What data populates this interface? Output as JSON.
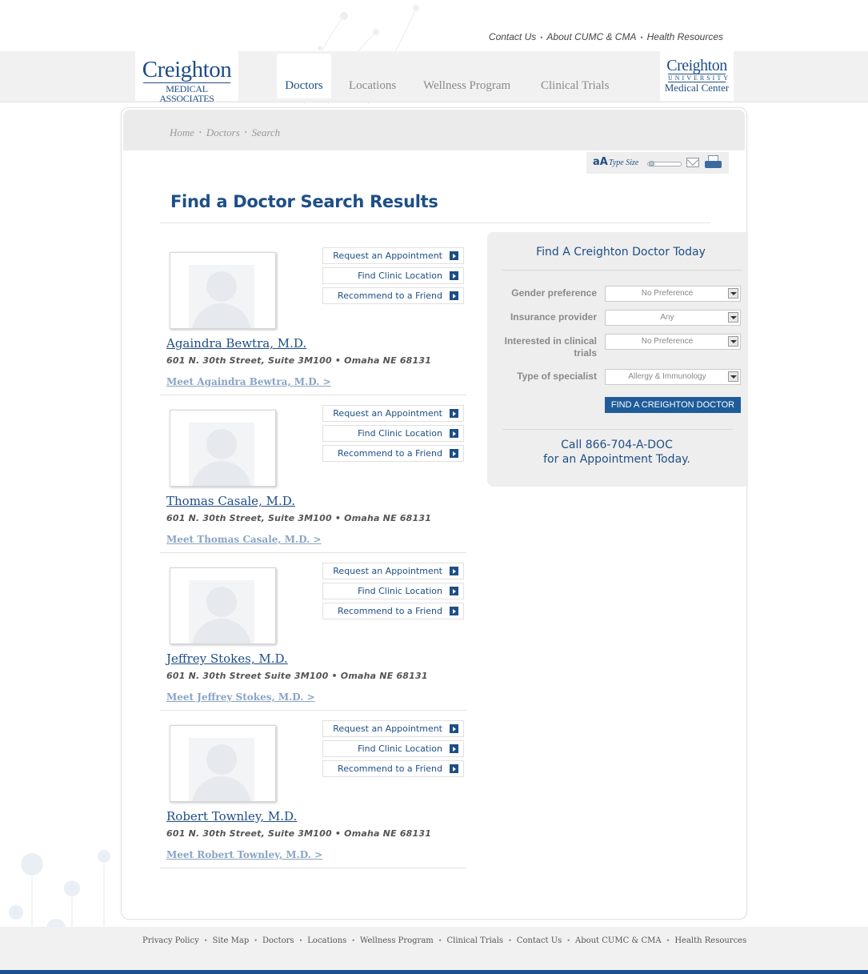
{
  "utility_nav": {
    "contact": "Contact Us",
    "about": "About CUMC & CMA",
    "health": "Health Resources",
    "separator": "•"
  },
  "logo_left": {
    "line1": "Creighton",
    "line2": "MEDICAL ASSOCIATES"
  },
  "logo_right": {
    "line1": "Creighton",
    "line2": "UNIVERSITY",
    "line3": "Medical Center"
  },
  "main_nav": {
    "doctors": "Doctors",
    "locations": "Locations",
    "wellness": "Wellness Program",
    "trials": "Clinical Trials"
  },
  "breadcrumb": {
    "home": "Home",
    "doctors": "Doctors",
    "search": "Search",
    "separator": "•"
  },
  "tools": {
    "aa": "aA",
    "type_size": "Type Size"
  },
  "page_title": "Find a Doctor Search Results",
  "buttons": {
    "appointment": "Request an Appointment",
    "location": "Find Clinic Location",
    "recommend": "Recommend to a Friend"
  },
  "doctors": [
    {
      "name": "Againdra Bewtra, M.D.",
      "address": "601 N. 30th Street, Suite 3M100 • Omaha NE 68131",
      "meet": "Meet Againdra Bewtra, M.D. >"
    },
    {
      "name": "Thomas Casale, M.D.",
      "address": "601 N. 30th Street, Suite 3M100 • Omaha NE 68131",
      "meet": "Meet Thomas Casale, M.D. >"
    },
    {
      "name": "Jeffrey Stokes, M.D.",
      "address": "601 N. 30th Street Suite 3M100 • Omaha NE 68131",
      "meet": "Meet Jeffrey Stokes, M.D. >"
    },
    {
      "name": "Robert Townley, M.D.",
      "address": "601 N. 30th Street, Suite 3M100 • Omaha NE 68131",
      "meet": "Meet Robert Townley, M.D. >"
    }
  ],
  "search": {
    "title": "Find A Creighton Doctor Today",
    "gender_label": "Gender preference",
    "gender_value": "No Preference",
    "insurance_label": "Insurance provider",
    "insurance_value": "Any",
    "trials_label_1": "Interested in clinical",
    "trials_label_2": "trials",
    "trials_value": "No Preference",
    "specialist_label": "Type of specialist",
    "specialist_value": "Allergy & Immunology",
    "find_button": "FIND A CREIGHTON DOCTOR",
    "call_line1": "Call 866-704-A-DOC",
    "call_line2": "for an Appointment Today."
  },
  "footer": {
    "privacy": "Privacy Policy",
    "sitemap": "Site Map",
    "doctors": "Doctors",
    "locations": "Locations",
    "wellness": "Wellness Program",
    "trials": "Clinical Trials",
    "contact": "Contact Us",
    "about": "About CUMC & CMA",
    "health": "Health Resources",
    "separator": "•"
  },
  "colors": {
    "brand_blue": "#1e4e86",
    "button_blue": "#1e5c99",
    "footer_bar": "#1e5099"
  }
}
